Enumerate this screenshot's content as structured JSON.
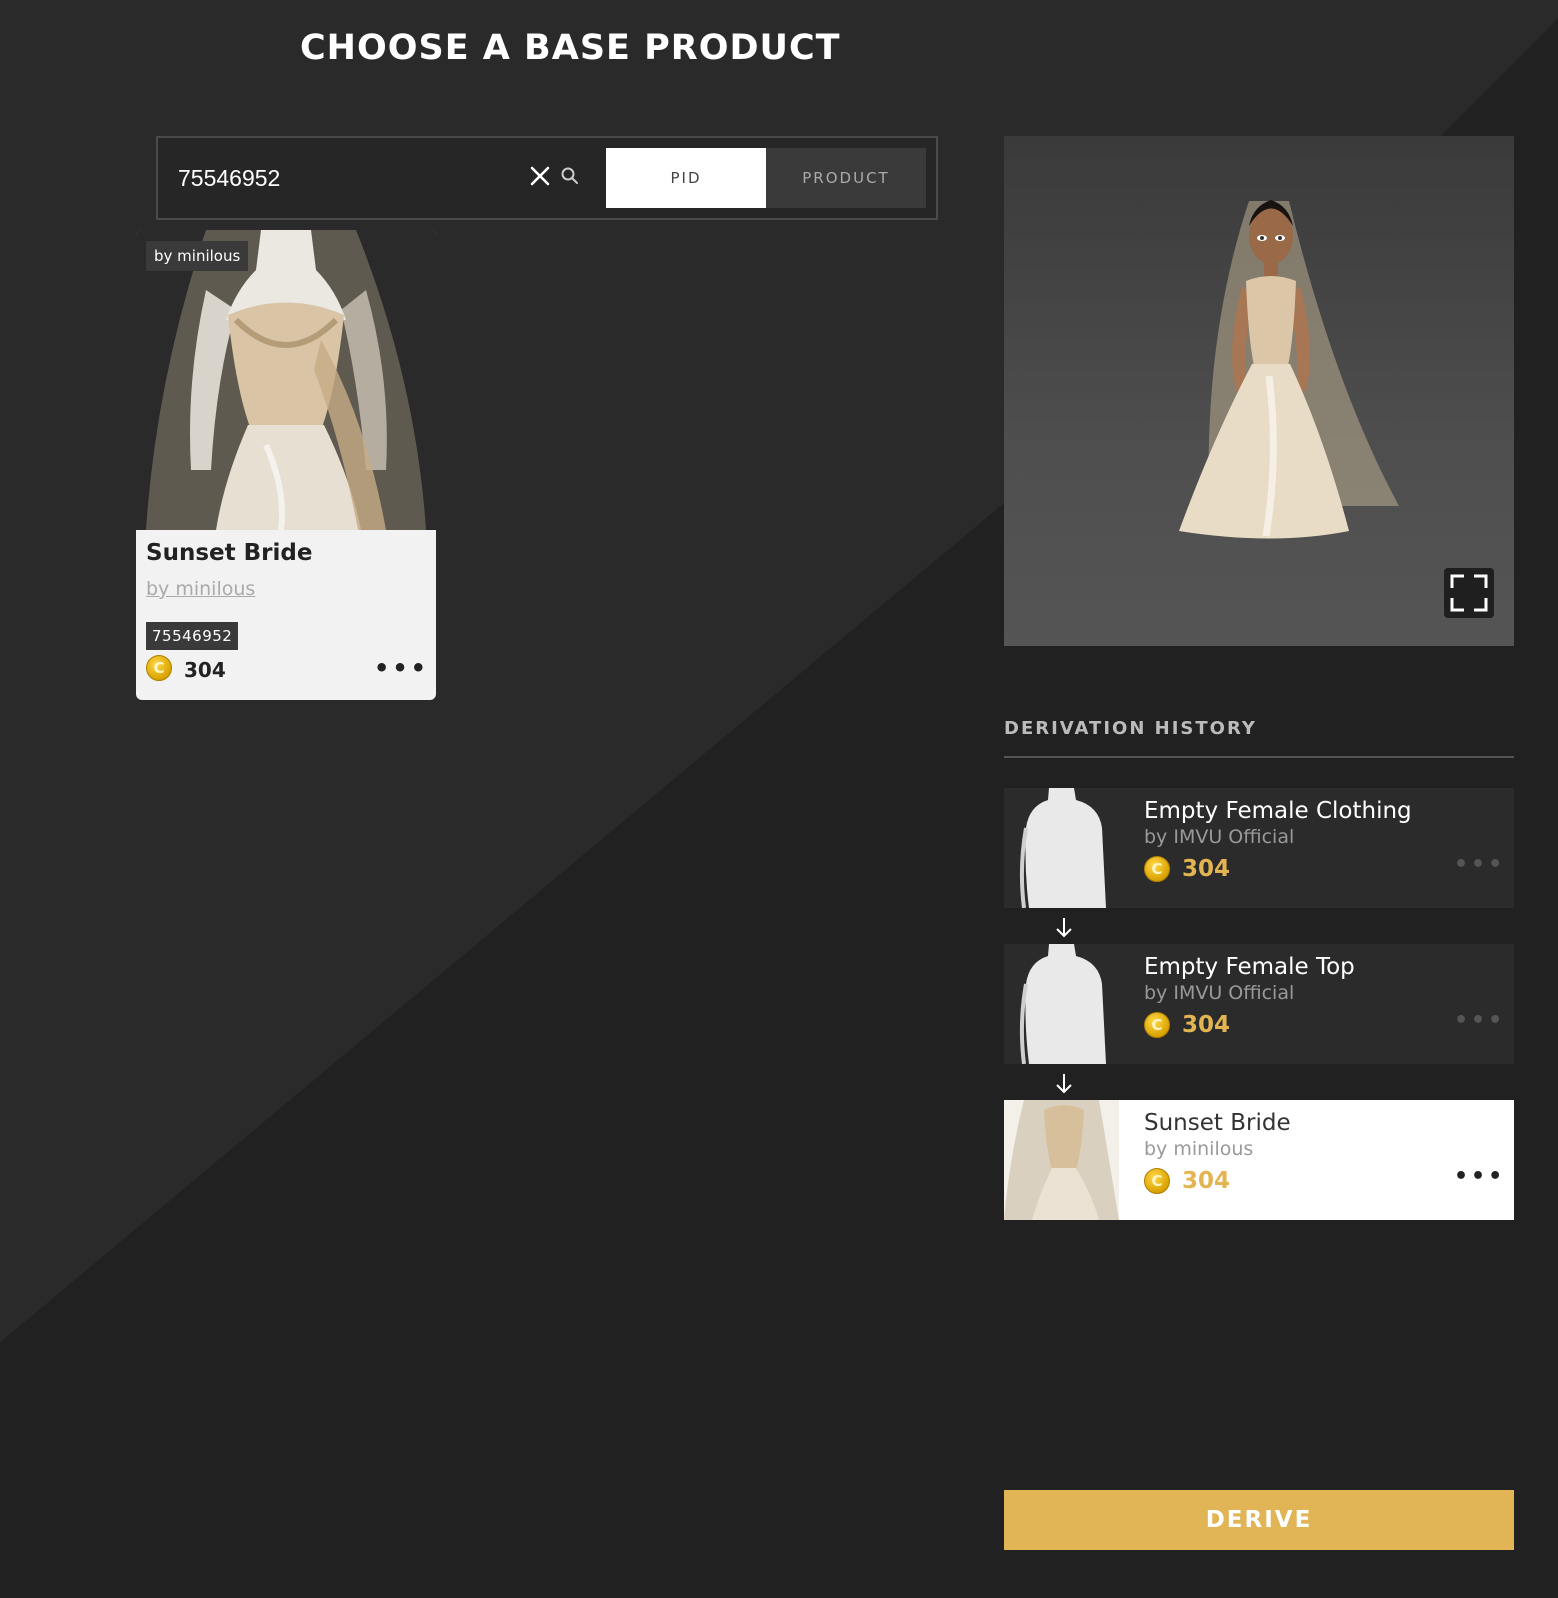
{
  "page": {
    "title": "CHOOSE A BASE PRODUCT"
  },
  "search": {
    "value": "75546952",
    "tabs": {
      "pid": "PID",
      "product": "PRODUCT"
    },
    "active_tab": "pid"
  },
  "result_card": {
    "author_badge": "by minilous",
    "name": "Sunset Bride",
    "by": "by minilous",
    "pid": "75546952",
    "price": "304",
    "more": "•••"
  },
  "derivation_history": {
    "title": "DERIVATION HISTORY",
    "items": [
      {
        "name": "Empty Female Clothing",
        "by": "by IMVU Official",
        "price": "304",
        "more": "•••"
      },
      {
        "name": "Empty Female Top",
        "by": "by IMVU Official",
        "price": "304",
        "more": "•••"
      },
      {
        "name": "Sunset Bride",
        "by": "by minilous",
        "price": "304",
        "more": "•••"
      }
    ]
  },
  "coin_glyph": "C",
  "actions": {
    "derive": "DERIVE"
  },
  "colors": {
    "background": "#212121",
    "accent": "#e1b456",
    "price": "#e3b552"
  }
}
